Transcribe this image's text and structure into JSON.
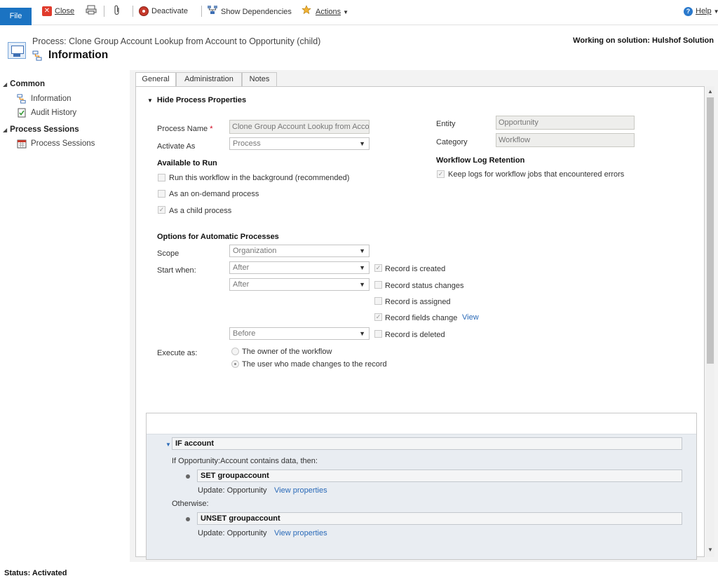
{
  "ribbon": {
    "file_label": "File",
    "close_label": "Close",
    "deactivate_label": "Deactivate",
    "show_dependencies_label": "Show Dependencies",
    "actions_label": "Actions",
    "help_label": "Help"
  },
  "header": {
    "record_subtitle": "Process: Clone Group Account Lookup from Account to Opportunity (child)",
    "title": "Information",
    "solution": "Working on solution: Hulshof Solution"
  },
  "nav": {
    "groups": [
      {
        "label": "Common",
        "items": [
          {
            "label": "Information",
            "icon": "process-icon"
          },
          {
            "label": "Audit History",
            "icon": "audit-icon"
          }
        ]
      },
      {
        "label": "Process Sessions",
        "items": [
          {
            "label": "Process Sessions",
            "icon": "calendar-icon"
          }
        ]
      }
    ]
  },
  "tabs": [
    {
      "label": "General",
      "active": true
    },
    {
      "label": "Administration",
      "active": false
    },
    {
      "label": "Notes",
      "active": false
    }
  ],
  "form": {
    "section_header": "Hide Process Properties",
    "process_name_label": "Process Name",
    "process_name_value": "Clone Group Account Lookup from Acco",
    "activate_as_label": "Activate As",
    "activate_as_value": "Process",
    "entity_label": "Entity",
    "entity_value": "Opportunity",
    "category_label": "Category",
    "category_value": "Workflow",
    "available_to_run_header": "Available to Run",
    "run_background_label": "Run this workflow in the background (recommended)",
    "on_demand_label": "As an on-demand process",
    "child_process_label": "As a child process",
    "log_retention_header": "Workflow Log Retention",
    "keep_logs_label": "Keep logs for workflow jobs that encountered errors",
    "auto_header": "Options for Automatic Processes",
    "scope_label": "Scope",
    "scope_value": "Organization",
    "start_when_label": "Start when:",
    "start_when_1": "After",
    "start_when_2": "After",
    "start_when_3": "Before",
    "record_created": "Record is created",
    "record_status": "Record status changes",
    "record_assigned": "Record is assigned",
    "record_fields": "Record fields change",
    "view_link": "View",
    "record_deleted": "Record is deleted",
    "execute_as_label": "Execute as:",
    "owner_label": "The owner of the workflow",
    "user_label": "The user who made changes to the record"
  },
  "designer": {
    "if_step": "IF account",
    "if_condition": "If Opportunity:Account contains data, then:",
    "set_step": "SET groupaccount",
    "update_label_1": "Update:  Opportunity",
    "view_properties_1": "View properties",
    "otherwise": "Otherwise:",
    "unset_step": "UNSET groupaccount",
    "update_label_2": "Update:  Opportunity",
    "view_properties_2": "View properties"
  },
  "status": "Status: Activated"
}
